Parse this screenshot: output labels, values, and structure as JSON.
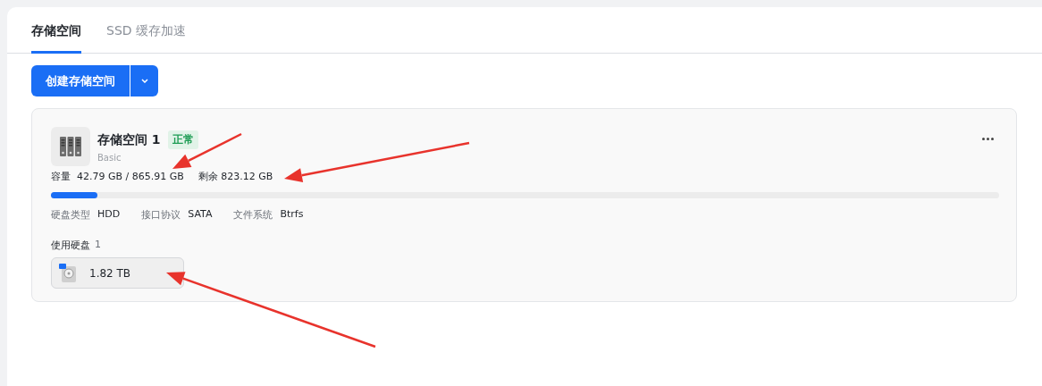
{
  "tabs": [
    {
      "label": "存储空间",
      "selected": true
    },
    {
      "label": "SSD 缓存加速",
      "selected": false
    }
  ],
  "create_button": {
    "label": "创建存储空间"
  },
  "pool": {
    "name": "存储空间 1",
    "status": "正常",
    "type": "Basic",
    "capacity_label": "容量",
    "capacity": "42.79 GB / 865.91 GB",
    "free_label": "剩余",
    "free": "823.12 GB",
    "level": 0.049,
    "properties": [
      {
        "label": "硬盘类型",
        "value": "HDD"
      },
      {
        "label": "接口协议",
        "value": "SATA"
      },
      {
        "label": "文件系统",
        "value": "Btrfs"
      }
    ],
    "disks_label": "使用硬盘",
    "disks_count": "1",
    "disks": [
      {
        "size": "1.82 TB"
      }
    ]
  }
}
